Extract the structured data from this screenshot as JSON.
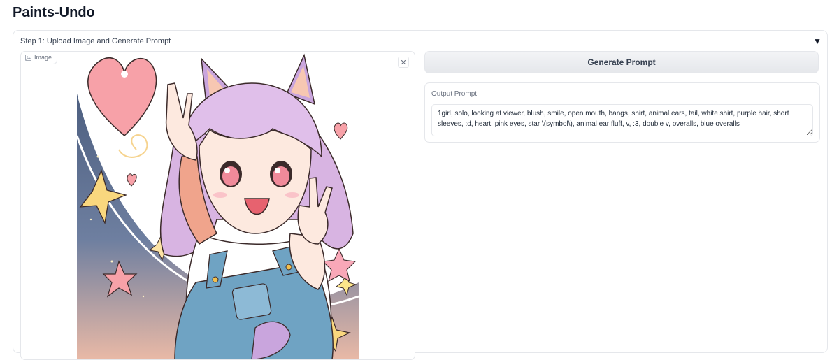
{
  "app": {
    "title": "Paints-Undo"
  },
  "step1": {
    "label": "Step 1: Upload Image and Generate Prompt",
    "toggle_icon": "triangle-down-icon",
    "image_input": {
      "tag_label": "Image",
      "tag_icon": "image-icon",
      "clear_icon": "close-icon"
    },
    "generate_button": {
      "label": "Generate Prompt"
    },
    "output_prompt": {
      "label": "Output Prompt",
      "value": "1girl, solo, looking at viewer, blush, smile, open mouth, bangs, shirt, animal ears, tail, white shirt, purple hair, short sleeves, :d, heart, pink eyes, star \\(symbol\\), animal ear fluff, v, :3, double v, overalls, blue overalls"
    }
  },
  "colors": {
    "border": "#e5e7eb",
    "button_bg": "#e5e7eb",
    "hair": "#d8b4e2",
    "overalls": "#6fa3c3",
    "heart": "#f7a1a8",
    "star": "#f9d77e",
    "sky": "#5b6f8f"
  }
}
